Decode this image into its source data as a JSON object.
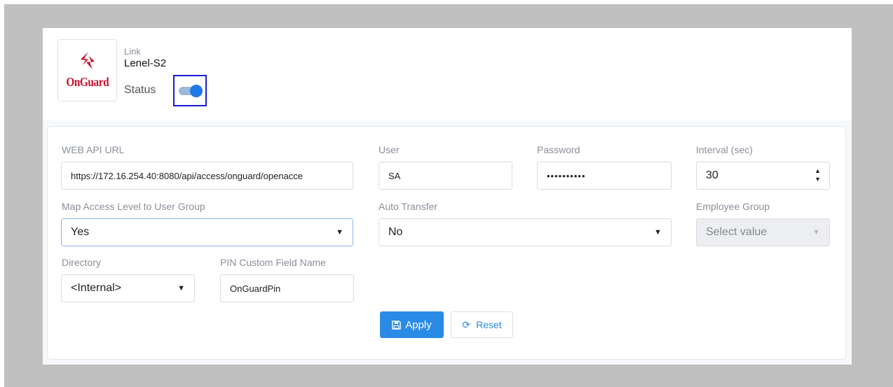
{
  "header": {
    "logo_text": "OnGuard",
    "link_caption": "Link",
    "link_name": "Lenel-S2",
    "status_label": "Status",
    "status_enabled": true
  },
  "form": {
    "web_api_url": {
      "label": "WEB API URL",
      "value": "https://172.16.254.40:8080/api/access/onguard/openacce"
    },
    "user": {
      "label": "User",
      "value": "SA"
    },
    "password": {
      "label": "Password",
      "value": "••••••••••"
    },
    "interval": {
      "label": "Interval (sec)",
      "value": "30"
    },
    "map_access_level": {
      "label": "Map Access Level to User Group",
      "value": "Yes"
    },
    "auto_transfer": {
      "label": "Auto Transfer",
      "value": "No"
    },
    "employee_group": {
      "label": "Employee Group",
      "placeholder": "Select value"
    },
    "directory": {
      "label": "Directory",
      "value": "<Internal>"
    },
    "pin_custom_field": {
      "label": "PIN Custom Field Name",
      "value": "OnGuardPin"
    }
  },
  "actions": {
    "apply_label": "Apply",
    "reset_label": "Reset"
  },
  "colors": {
    "accent": "#2a8be6",
    "toggle_on": "#1e7ae6",
    "brand_red": "#c8102e",
    "focus_outline": "#1a1adc"
  }
}
